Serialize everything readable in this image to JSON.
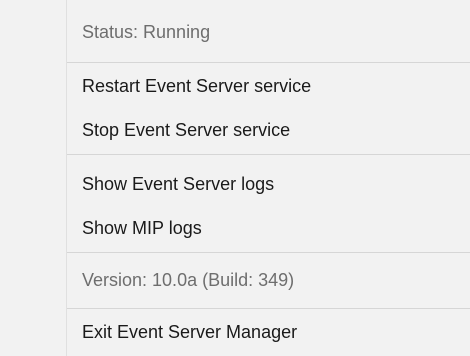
{
  "menu": {
    "status_label": "Status: Running",
    "restart_label": "Restart Event Server service",
    "stop_label": "Stop Event Server service",
    "show_event_logs_label": "Show Event Server logs",
    "show_mip_logs_label": "Show MIP logs",
    "version_label": "Version: 10.0a (Build: 349)",
    "exit_label": "Exit Event Server Manager"
  },
  "colors": {
    "background": "#f2f2f2",
    "text": "#1a1a1a",
    "disabled_text": "#6e6e6e",
    "separator": "#d6d6d6"
  }
}
